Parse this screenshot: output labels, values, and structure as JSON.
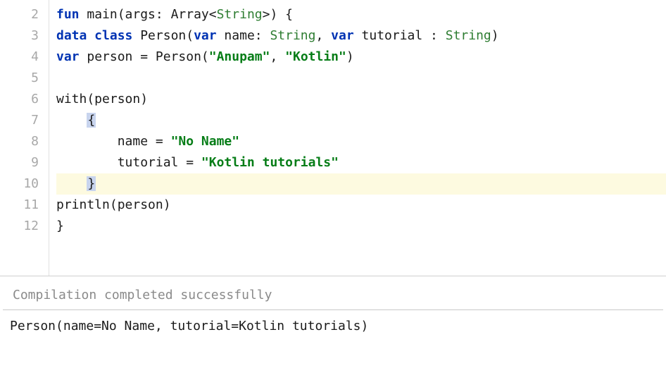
{
  "editor": {
    "startLine": 2,
    "endLine": 12,
    "highlightedLine": 10,
    "lines": {
      "2": [
        {
          "t": "fun",
          "c": "kw"
        },
        {
          "t": " ",
          "c": "plain"
        },
        {
          "t": "main(args: Array<",
          "c": "plain"
        },
        {
          "t": "String",
          "c": "type"
        },
        {
          "t": ">) {",
          "c": "plain"
        }
      ],
      "3": [
        {
          "t": "data class",
          "c": "kw"
        },
        {
          "t": " ",
          "c": "plain"
        },
        {
          "t": "Person(",
          "c": "plain"
        },
        {
          "t": "var",
          "c": "kw"
        },
        {
          "t": " name: ",
          "c": "plain"
        },
        {
          "t": "String",
          "c": "type"
        },
        {
          "t": ", ",
          "c": "plain"
        },
        {
          "t": "var",
          "c": "kw"
        },
        {
          "t": " tutorial : ",
          "c": "plain"
        },
        {
          "t": "String",
          "c": "type"
        },
        {
          "t": ")",
          "c": "plain"
        }
      ],
      "4": [
        {
          "t": "var",
          "c": "kw"
        },
        {
          "t": " person = Person(",
          "c": "plain"
        },
        {
          "t": "\"Anupam\"",
          "c": "str"
        },
        {
          "t": ", ",
          "c": "plain"
        },
        {
          "t": "\"Kotlin\"",
          "c": "str"
        },
        {
          "t": ")",
          "c": "plain"
        }
      ],
      "5": [],
      "6": [
        {
          "t": "with(person)",
          "c": "plain"
        }
      ],
      "7": [
        {
          "t": "    ",
          "c": "plain"
        },
        {
          "t": "{",
          "c": "plain",
          "hl": true
        }
      ],
      "8": [
        {
          "t": "        name = ",
          "c": "plain"
        },
        {
          "t": "\"No Name\"",
          "c": "str"
        }
      ],
      "9": [
        {
          "t": "        tutorial = ",
          "c": "plain"
        },
        {
          "t": "\"Kotlin tutorials\"",
          "c": "str"
        }
      ],
      "10": [
        {
          "t": "    ",
          "c": "plain"
        },
        {
          "t": "}",
          "c": "plain",
          "hl": true
        }
      ],
      "11": [
        {
          "t": "println(person)",
          "c": "plain"
        }
      ],
      "12": [
        {
          "t": "}",
          "c": "plain"
        }
      ]
    }
  },
  "status": "Compilation completed successfully",
  "output": "Person(name=No Name, tutorial=Kotlin tutorials)"
}
